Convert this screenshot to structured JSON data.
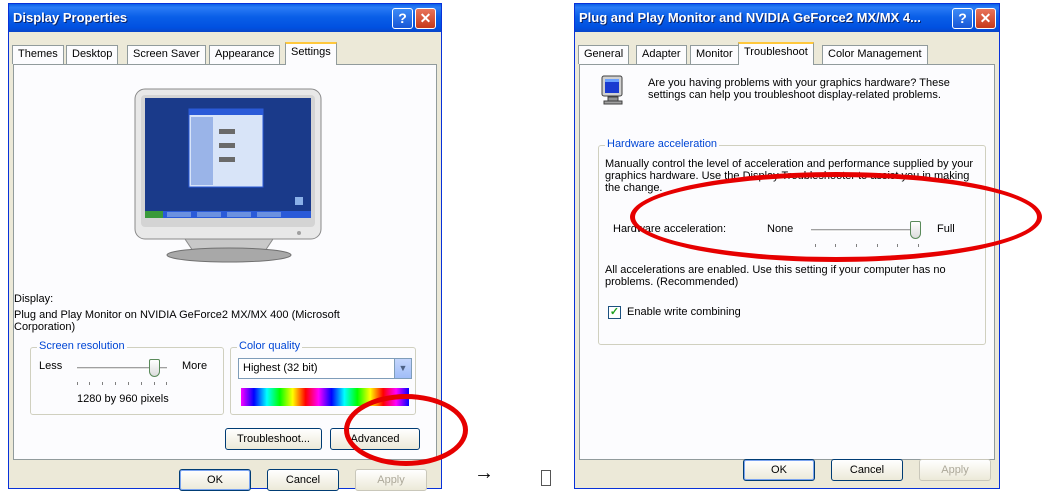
{
  "left_window": {
    "title": "Display Properties",
    "tabs": [
      "Themes",
      "Desktop",
      "Screen Saver",
      "Appearance",
      "Settings"
    ],
    "active_tab": "Settings",
    "display_label": "Display:",
    "display_value": "Plug and Play Monitor on NVIDIA GeForce2 MX/MX 400 (Microsoft Corporation)",
    "screen_resolution": {
      "legend": "Screen resolution",
      "less": "Less",
      "more": "More",
      "value_text": "1280 by 960 pixels",
      "level": 0.86
    },
    "color_quality": {
      "legend": "Color quality",
      "selected": "Highest (32 bit)"
    },
    "buttons": {
      "troubleshoot": "Troubleshoot...",
      "advanced": "Advanced",
      "ok": "OK",
      "cancel": "Cancel",
      "apply": "Apply"
    }
  },
  "arrow": "→",
  "right_window": {
    "title": "Plug and Play Monitor and NVIDIA GeForce2 MX/MX 4...",
    "tabs": [
      "General",
      "Adapter",
      "Monitor",
      "Troubleshoot",
      "Color Management"
    ],
    "active_tab": "Troubleshoot",
    "intro": "Are you having problems with your graphics hardware? These settings can help you troubleshoot display-related problems.",
    "hardware_acceleration": {
      "legend": "Hardware acceleration",
      "description": "Manually control the level of acceleration and performance supplied by your graphics hardware. Use the Display Troubleshooter to assist you in making the change.",
      "slider_label": "Hardware acceleration:",
      "none": "None",
      "full": "Full",
      "level": 1.0,
      "status": "All accelerations are enabled. Use this setting if your computer has no problems. (Recommended)",
      "write_combining_label": "Enable write combining",
      "write_combining_checked": true
    },
    "buttons": {
      "ok": "OK",
      "cancel": "Cancel",
      "apply": "Apply"
    }
  },
  "colors": {
    "titlebar": "#0a5fe8",
    "highlight": "#e60000",
    "legend_text": "#0046d5"
  }
}
